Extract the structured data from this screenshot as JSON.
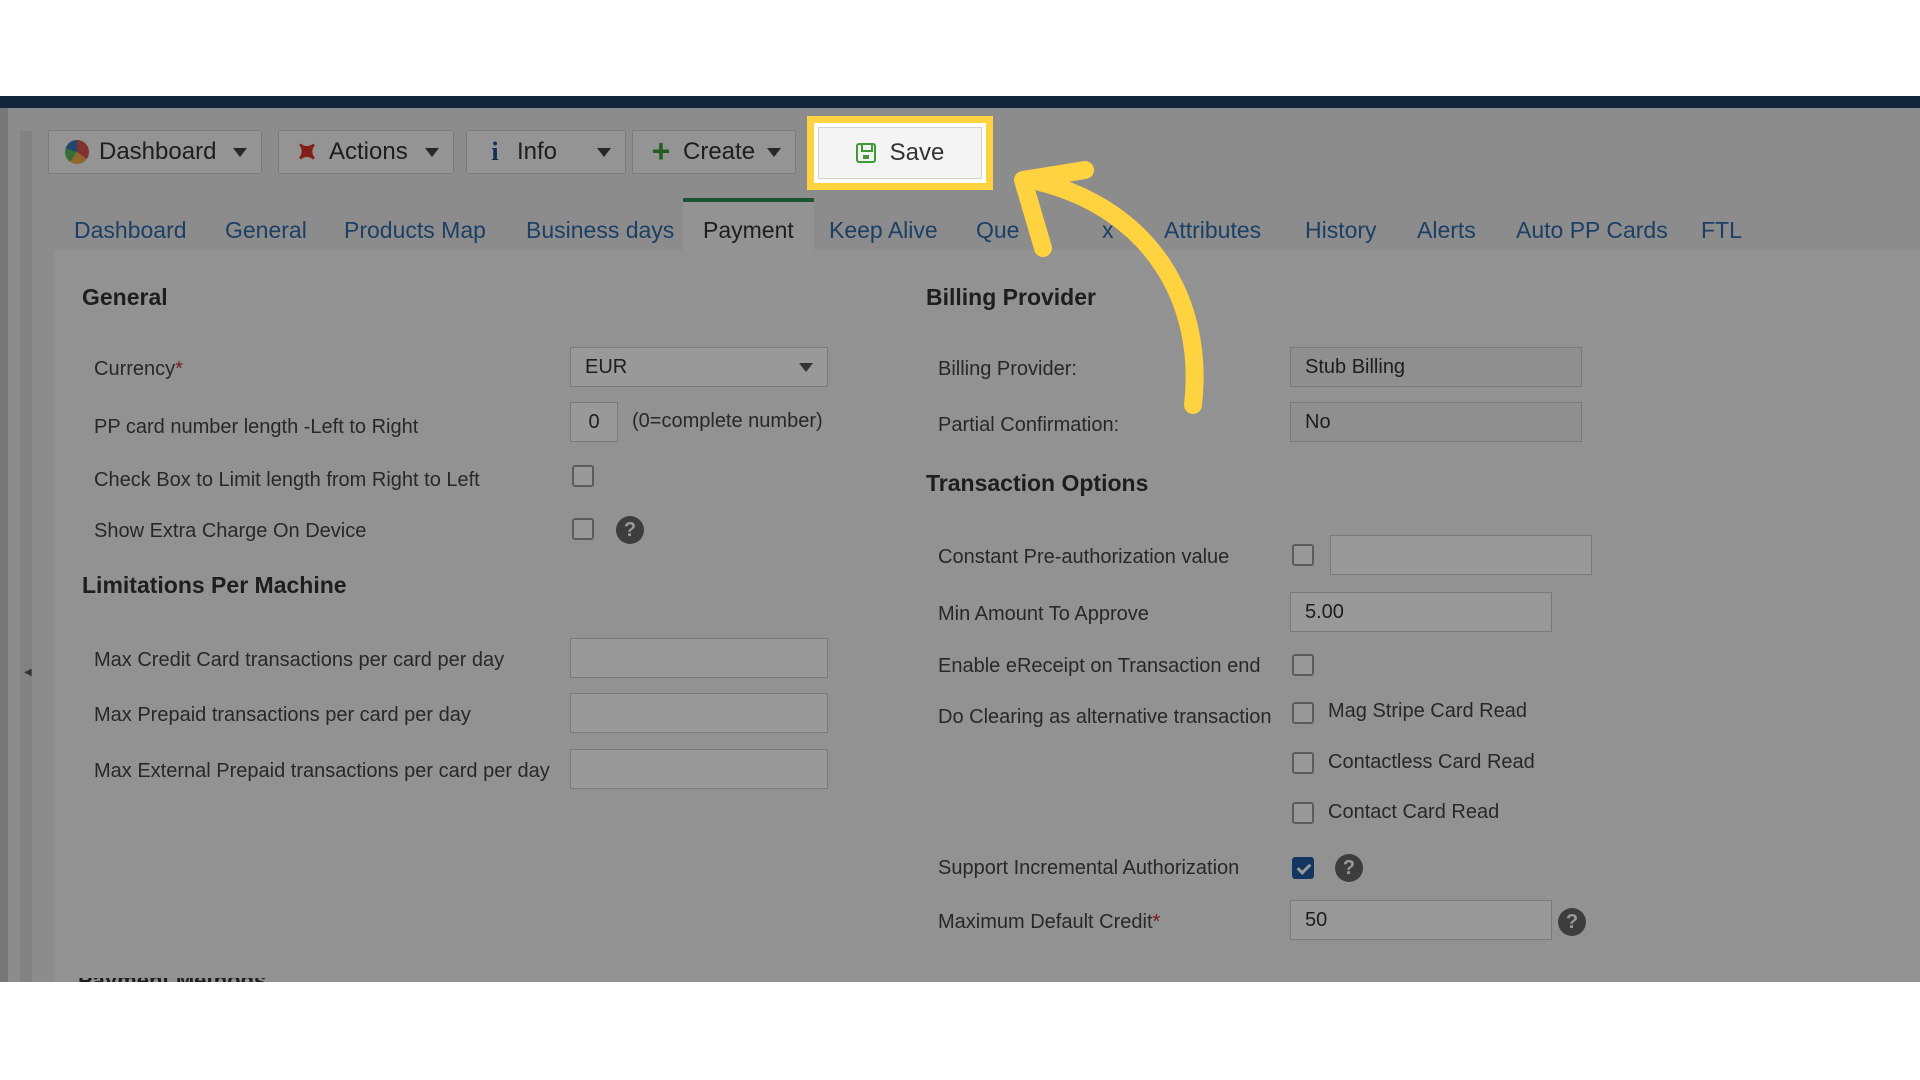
{
  "toolbar": {
    "dashboard": "Dashboard",
    "actions": "Actions",
    "info": "Info",
    "create": "Create",
    "save": "Save"
  },
  "tabs": [
    "Dashboard",
    "General",
    "Products Map",
    "Business days",
    "Payment",
    "Keep Alive",
    "Que",
    "x",
    "Attributes",
    "History",
    "Alerts",
    "Auto PP Cards",
    "FTL"
  ],
  "active_tab": "Payment",
  "general": {
    "title": "General",
    "currency_label": "Currency",
    "currency_value": "EUR",
    "pp_length_label": "PP card number length -Left to Right",
    "pp_length_value": "0",
    "pp_length_hint": "(0=complete number)",
    "limit_rtl_label": "Check Box to Limit length from Right to Left",
    "extra_charge_label": "Show Extra Charge On Device"
  },
  "limitations": {
    "title": "Limitations Per Machine",
    "max_credit_label": "Max Credit Card transactions per card per day",
    "max_prepaid_label": "Max Prepaid transactions per card per day",
    "max_ext_prepaid_label": "Max External Prepaid transactions per card per day"
  },
  "billing": {
    "title": "Billing Provider",
    "provider_label": "Billing Provider:",
    "provider_value": "Stub Billing",
    "partial_label": "Partial Confirmation:",
    "partial_value": "No"
  },
  "transaction": {
    "title": "Transaction Options",
    "const_preauth_label": "Constant Pre-authorization value",
    "min_amount_label": "Min Amount To Approve",
    "min_amount_value": "5.00",
    "ereceipt_label": "Enable eReceipt on Transaction end",
    "clearing_label": "Do Clearing as alternative transaction",
    "mag_stripe": "Mag Stripe Card Read",
    "contactless": "Contactless Card Read",
    "contact": "Contact Card Read",
    "incremental_label": "Support Incremental Authorization",
    "incremental_checked": true,
    "max_credit_label": "Maximum Default Credit",
    "max_credit_value": "50"
  },
  "required_mark": "*",
  "help_glyph": "?",
  "colors": {
    "highlight": "#ffd23f",
    "link": "#2f6aa8",
    "active_tab_border": "#2e8b57",
    "checkbox_checked": "#1f5b9e",
    "topbar": "#1f3e63"
  }
}
